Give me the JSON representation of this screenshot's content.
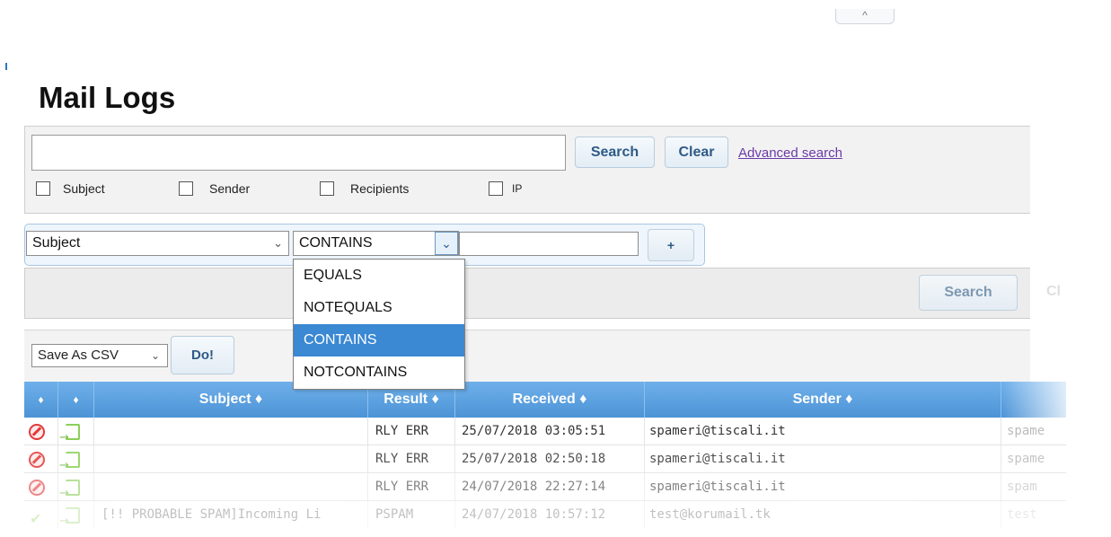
{
  "page": {
    "title": "Mail Logs",
    "collapse_glyph": "^"
  },
  "search": {
    "input_value": "",
    "search_label": "Search",
    "clear_label": "Clear",
    "advanced_link": "Advanced search",
    "checkboxes": [
      {
        "label": "Subject",
        "checked": false
      },
      {
        "label": "Sender",
        "checked": false
      },
      {
        "label": "Recipients",
        "checked": false
      },
      {
        "label": "IP",
        "checked": false
      }
    ]
  },
  "filter": {
    "field_select": "Subject",
    "operator_select": "CONTAINS",
    "value": "",
    "add_label": "+",
    "operator_options": [
      "EQUALS",
      "NOTEQUALS",
      "CONTAINS",
      "NOTCONTAINS"
    ],
    "selected_option": "CONTAINS",
    "search_label": "Search",
    "clear_label": "Cl"
  },
  "export": {
    "format_select": "Save As CSV",
    "do_label": "Do!"
  },
  "table": {
    "headers": [
      "♦",
      "♦",
      "Subject ♦",
      "Result ♦",
      "Received ♦",
      "Sender ♦",
      ""
    ],
    "rows": [
      {
        "icon1": "block-icon",
        "icon2": "incoming-icon",
        "subject": "",
        "result": "RLY ERR",
        "received": "25/07/2018 03:05:51",
        "sender": "spameri@tiscali.it",
        "extra": "spame"
      },
      {
        "icon1": "block-icon",
        "icon2": "incoming-icon",
        "subject": "",
        "result": "RLY ERR",
        "received": "25/07/2018 02:50:18",
        "sender": "spameri@tiscali.it",
        "extra": "spame"
      },
      {
        "icon1": "block-icon",
        "icon2": "incoming-icon",
        "subject": "",
        "result": "RLY ERR",
        "received": "24/07/2018 22:27:14",
        "sender": "spameri@tiscali.it",
        "extra": "spam"
      },
      {
        "icon1": "check-icon",
        "icon2": "incoming-icon",
        "subject": "[!! PROBABLE SPAM]Incoming Li",
        "result": "PSPAM",
        "received": "24/07/2018 10:57:12",
        "sender": "test@korumail.tk",
        "extra": "test"
      }
    ]
  },
  "colors": {
    "header_blue": "#4c93d6",
    "selected_option": "#3b88d3",
    "button_text": "#2e5a87",
    "link": "#6b39a8"
  }
}
